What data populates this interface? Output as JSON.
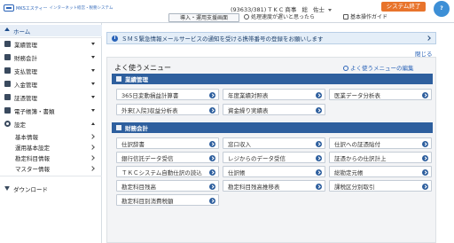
{
  "header": {
    "logo_text": "MKSエスティー",
    "logo_sub": "インターネット経営・税務システム",
    "user_info": "(93633/381) T K C 商事",
    "user_role": "総",
    "user_name": "佐士",
    "system_end": "システム終了",
    "avatar": "?",
    "intro_support": "導入・運用支援画面",
    "speed_help": "処理速度が遅いと思ったら",
    "basic_guide": "基本操作ガイド"
  },
  "sidebar": {
    "items": [
      {
        "label": "ホーム"
      },
      {
        "label": "業績管理"
      },
      {
        "label": "財務会計"
      },
      {
        "label": "支払管理"
      },
      {
        "label": "入金管理"
      },
      {
        "label": "証憑管理"
      },
      {
        "label": "電子帳簿・書類"
      },
      {
        "label": "設定"
      }
    ],
    "settings_sub": [
      {
        "label": "基本情報"
      },
      {
        "label": "運用基本設定"
      },
      {
        "label": "勘定科目情報"
      },
      {
        "label": "マスター情報"
      }
    ],
    "download": "ダウンロード"
  },
  "notice": {
    "text": "ＳＭＳ緊急情報メールサービスの通知を受ける携帯番号の登録をお願いします",
    "close": "閉じる"
  },
  "menu": {
    "title": "よく使うメニュー",
    "edit": "よく使うメニューの編集",
    "section1": {
      "title": "業績管理",
      "buttons": [
        "365日変動損益計算書",
        "年度業績対照表",
        "医業データ分析表",
        "外来[入院]収益分析表",
        "資金繰り実績表"
      ]
    },
    "section2": {
      "title": "財務会計",
      "buttons": [
        "仕訳辞書",
        "窓口収入",
        "仕訳への証憑貼付",
        "銀行信託データ受信",
        "レジからのデータ受信",
        "証憑からの仕訳計上",
        "ＴＫＣシステム自動仕訳の読込",
        "仕訳帳",
        "総勘定元帳",
        "勘定科目残高",
        "勘定科目残高推移表",
        "課税区分別取引",
        "勘定科目別消費税額"
      ]
    }
  }
}
